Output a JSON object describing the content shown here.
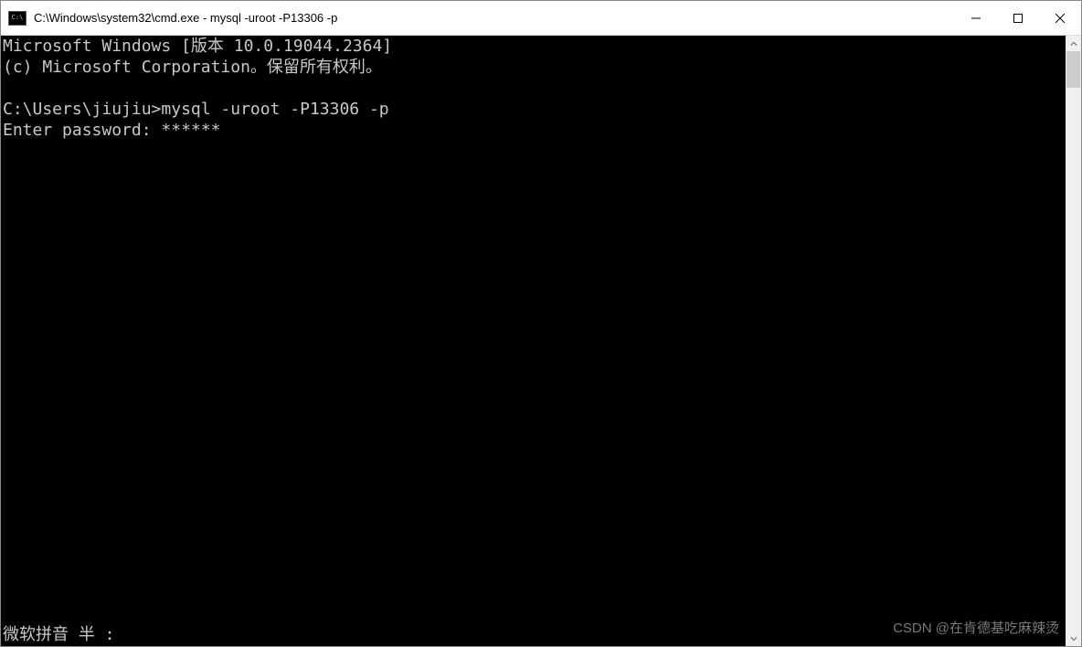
{
  "window": {
    "title": "C:\\Windows\\system32\\cmd.exe - mysql  -uroot -P13306 -p"
  },
  "terminal": {
    "line1": "Microsoft Windows [版本 10.0.19044.2364]",
    "line2": "(c) Microsoft Corporation。保留所有权利。",
    "blank1": "",
    "prompt_line": "C:\\Users\\jiujiu>mysql -uroot -P13306 -p",
    "password_line": "Enter password: ******"
  },
  "ime": {
    "status": "微软拼音 半 :"
  },
  "watermark": {
    "text": "CSDN @在肯德基吃麻辣烫"
  }
}
